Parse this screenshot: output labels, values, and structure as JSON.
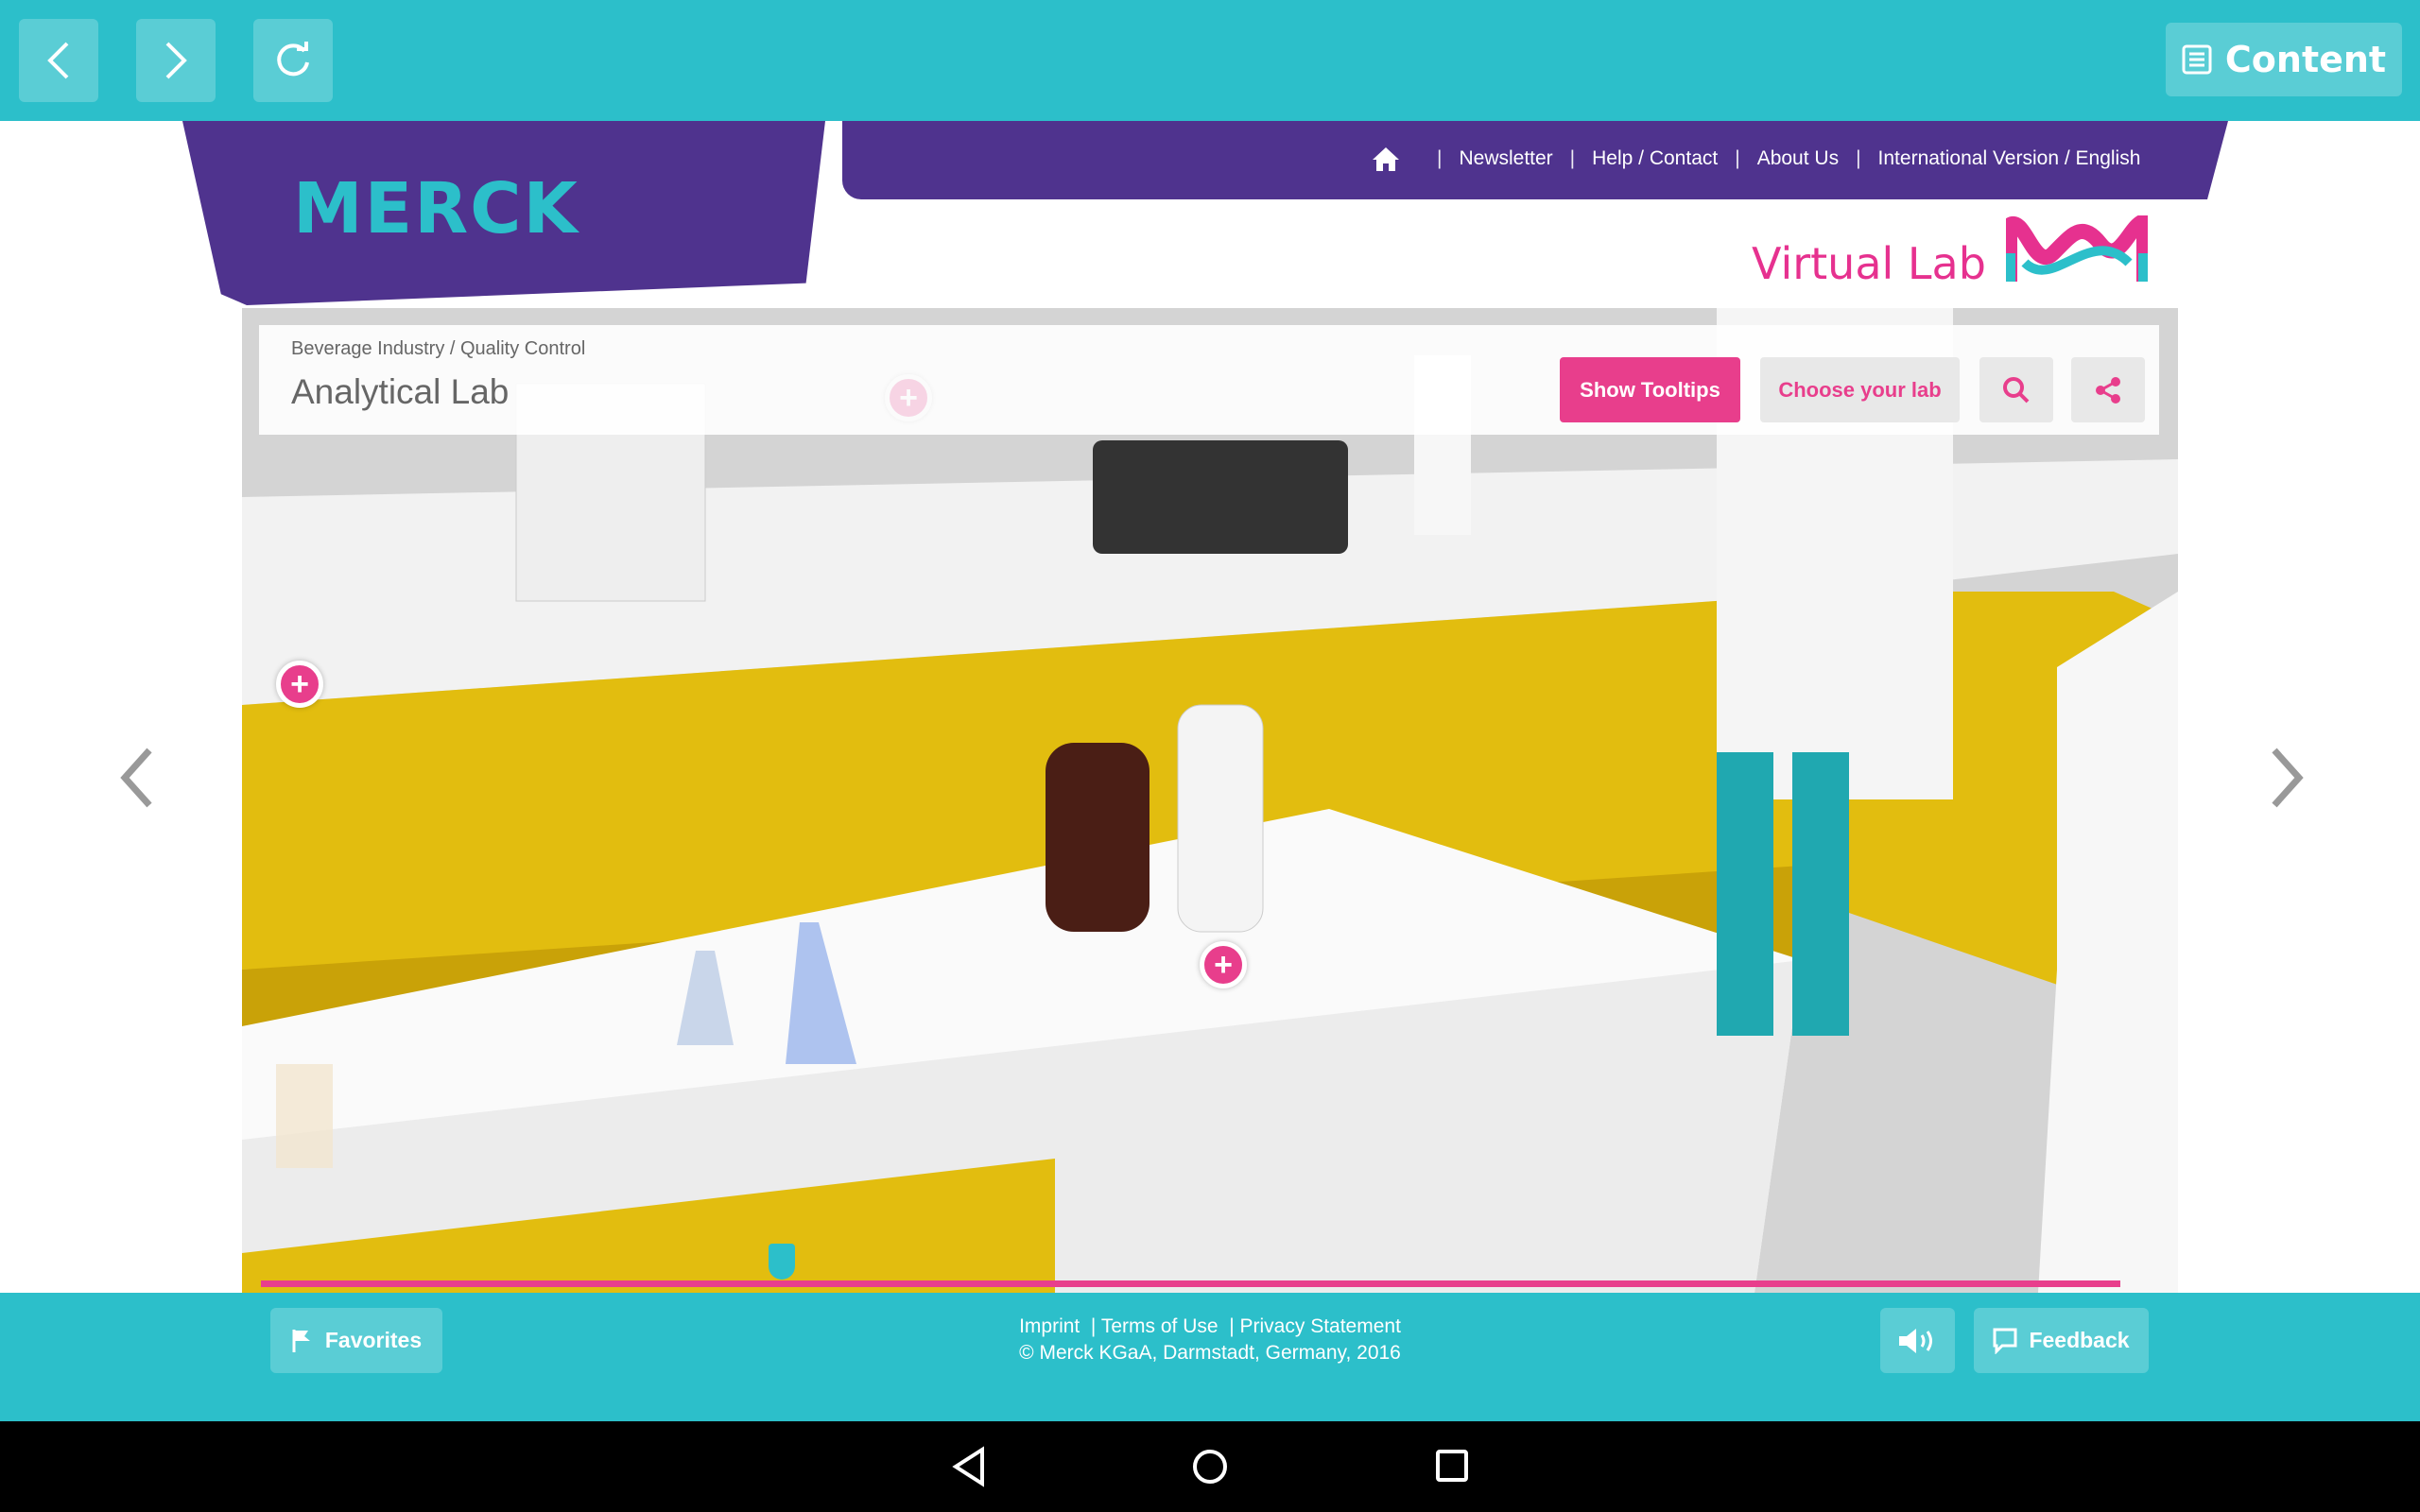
{
  "topbar": {
    "back_icon": "chevron-left-icon",
    "forward_icon": "chevron-right-icon",
    "reload_icon": "reload-icon",
    "content_label": "Content"
  },
  "header": {
    "logo": "MERCK",
    "nav": {
      "home_icon": "home-icon",
      "items": [
        "Newsletter",
        "Help / Contact",
        "About Us",
        "International Version / English"
      ]
    },
    "virtual_lab": "Virtual Lab"
  },
  "lab": {
    "breadcrumb": "Beverage Industry / Quality Control",
    "title": "Analytical Lab",
    "show_tooltips": "Show Tooltips",
    "choose_lab": "Choose your lab",
    "progress_percent": 28
  },
  "footer": {
    "favorites": "Favorites",
    "links": [
      "Imprint",
      "Terms of Use",
      "Privacy Statement"
    ],
    "copyright": "© Merck KGaA, Darmstadt, Germany, 2016",
    "feedback": "Feedback"
  },
  "colors": {
    "teal": "#2cbfca",
    "purple": "#4f338e",
    "pink": "#e83e8c"
  }
}
